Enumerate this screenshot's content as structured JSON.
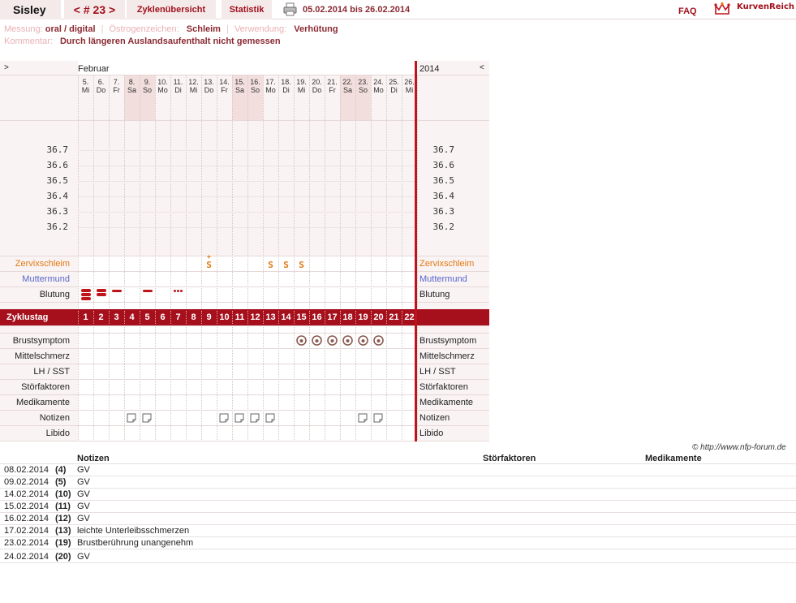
{
  "header": {
    "name": "Sisley",
    "cycle_prev": "<",
    "cycle_label": "# 23",
    "cycle_next": ">",
    "tab_overview": "Zyklenübersicht",
    "tab_stats": "Statistik",
    "date_range": "05.02.2014 bis 26.02.2014",
    "faq": "FAQ",
    "logo": "KurvenReich"
  },
  "info": {
    "messung_label": "Messung:",
    "messung_value": "oral / digital",
    "oestrogen_label": "Östrogenzeichen:",
    "oestrogen_value": "Schleim",
    "verwendung_label": "Verwendung:",
    "verwendung_value": "Verhütung",
    "kommentar_label": "Kommentar:",
    "kommentar_value": "Durch längeren Auslandsaufenthalt nicht gemessen"
  },
  "chart": {
    "nav_prev": ">",
    "nav_next": "<",
    "month": "Februar",
    "year": "2014",
    "days": [
      {
        "num": "5.",
        "wd": "Mi",
        "weekend": false
      },
      {
        "num": "6.",
        "wd": "Do",
        "weekend": false
      },
      {
        "num": "7.",
        "wd": "Fr",
        "weekend": false
      },
      {
        "num": "8.",
        "wd": "Sa",
        "weekend": true
      },
      {
        "num": "9.",
        "wd": "So",
        "weekend": true
      },
      {
        "num": "10.",
        "wd": "Mo",
        "weekend": false
      },
      {
        "num": "11.",
        "wd": "Di",
        "weekend": false
      },
      {
        "num": "12.",
        "wd": "Mi",
        "weekend": false
      },
      {
        "num": "13.",
        "wd": "Do",
        "weekend": false
      },
      {
        "num": "14.",
        "wd": "Fr",
        "weekend": false
      },
      {
        "num": "15.",
        "wd": "Sa",
        "weekend": true
      },
      {
        "num": "16.",
        "wd": "So",
        "weekend": true
      },
      {
        "num": "17.",
        "wd": "Mo",
        "weekend": false
      },
      {
        "num": "18.",
        "wd": "Di",
        "weekend": false
      },
      {
        "num": "19.",
        "wd": "Mi",
        "weekend": false
      },
      {
        "num": "20.",
        "wd": "Do",
        "weekend": false
      },
      {
        "num": "21.",
        "wd": "Fr",
        "weekend": false
      },
      {
        "num": "22.",
        "wd": "Sa",
        "weekend": true
      },
      {
        "num": "23.",
        "wd": "So",
        "weekend": true
      },
      {
        "num": "24.",
        "wd": "Mo",
        "weekend": false
      },
      {
        "num": "25.",
        "wd": "Di",
        "weekend": false
      },
      {
        "num": "26.",
        "wd": "Mi",
        "weekend": false
      }
    ],
    "temps": [
      "36.7",
      "36.6",
      "36.5",
      "36.4",
      "36.3",
      "36.2"
    ],
    "labels": {
      "zervix": "Zervixschleim",
      "muttermund": "Muttermund",
      "blutung": "Blutung",
      "zyklustag": "Zyklustag",
      "brust": "Brustsymptom",
      "mittel": "Mittelschmerz",
      "lh": "LH / SST",
      "stoer": "Störfaktoren",
      "medi": "Medikamente",
      "notizen": "Notizen",
      "libido": "Libido"
    },
    "cycle_days": [
      "1",
      "2",
      "3",
      "4",
      "5",
      "6",
      "7",
      "8",
      "9",
      "10",
      "11",
      "12",
      "13",
      "14",
      "15",
      "16",
      "17",
      "18",
      "19",
      "20",
      "21",
      "22"
    ],
    "zervix_symbols": [
      {
        "day": 9,
        "symbol": "S+"
      },
      {
        "day": 13,
        "symbol": "S"
      },
      {
        "day": 14,
        "symbol": "S"
      },
      {
        "day": 15,
        "symbol": "S"
      }
    ],
    "bleeding": [
      {
        "day": 1,
        "level": "heavy"
      },
      {
        "day": 2,
        "level": "medium"
      },
      {
        "day": 3,
        "level": "light"
      },
      {
        "day": 5,
        "level": "light"
      },
      {
        "day": 7,
        "level": "spotting"
      }
    ],
    "breast_days": [
      15,
      16,
      17,
      18,
      19,
      20
    ],
    "note_days": [
      4,
      5,
      10,
      11,
      12,
      13,
      19,
      20
    ],
    "colors": {
      "accent": "#a5101c",
      "zervix": "#e27812",
      "muttermund": "#5566cc",
      "weekend": "#f3dede"
    }
  },
  "copyright": "© http://www.nfp-forum.de",
  "notes_table": {
    "headers": {
      "notizen": "Notizen",
      "stoerfaktoren": "Störfaktoren",
      "medikamente": "Medikamente"
    },
    "rows": [
      {
        "date": "08.02.2014",
        "day": "(4)",
        "text": "GV"
      },
      {
        "date": "09.02.2014",
        "day": "(5)",
        "text": "GV"
      },
      {
        "date": "14.02.2014",
        "day": "(10)",
        "text": "GV"
      },
      {
        "date": "15.02.2014",
        "day": "(11)",
        "text": "GV"
      },
      {
        "date": "16.02.2014",
        "day": "(12)",
        "text": "GV"
      },
      {
        "date": "17.02.2014",
        "day": "(13)",
        "text": "leichte Unterleibsschmerzen"
      },
      {
        "date": "23.02.2014",
        "day": "(19)",
        "text": "Brustberührung unangenehm"
      },
      {
        "date": "24.02.2014",
        "day": "(20)",
        "text": "GV"
      }
    ]
  }
}
